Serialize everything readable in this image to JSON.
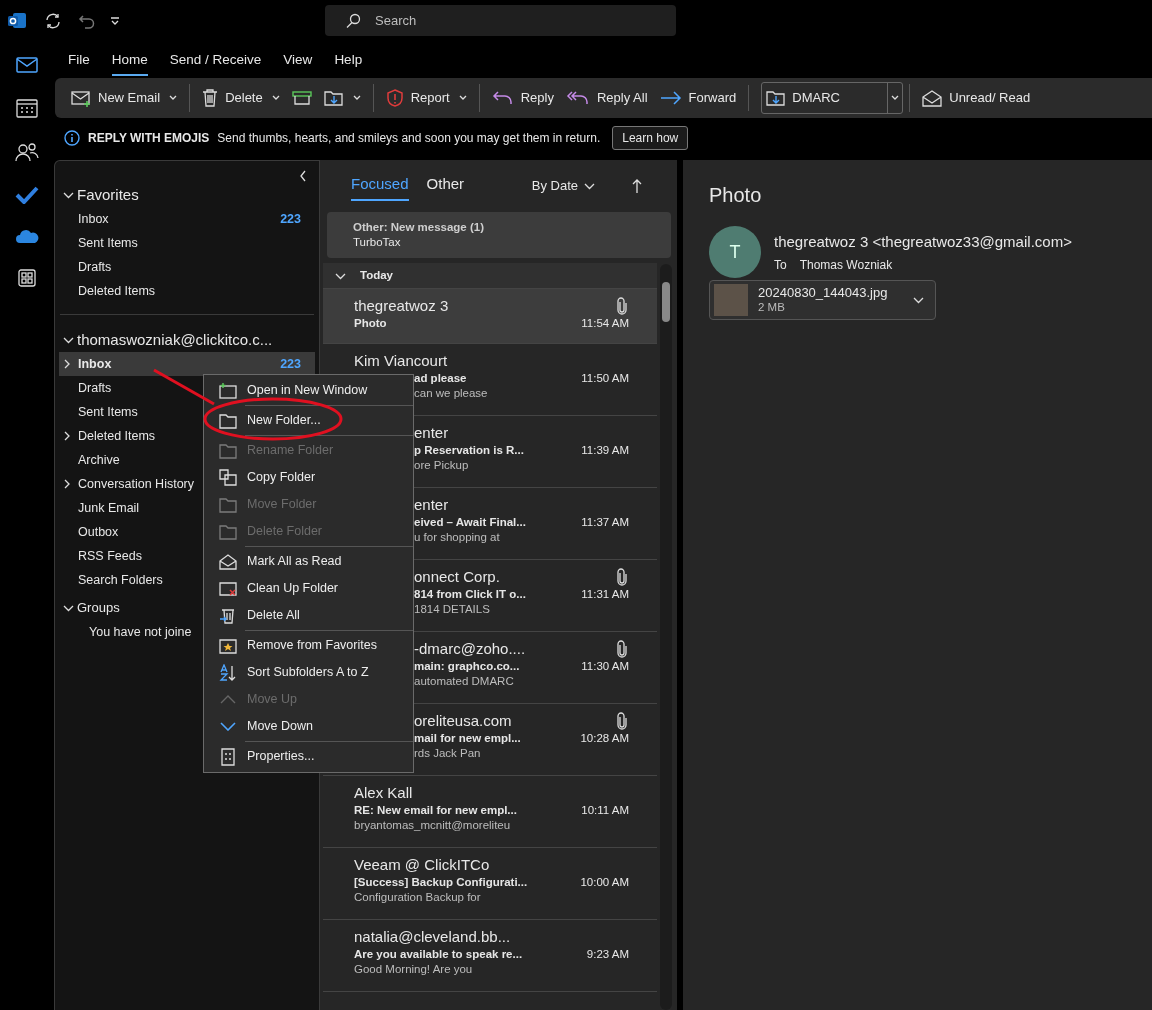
{
  "title_bar": {
    "search_placeholder": "Search"
  },
  "menu_tabs": [
    {
      "label": "File",
      "selected": false
    },
    {
      "label": "Home",
      "selected": true
    },
    {
      "label": "Send / Receive",
      "selected": false
    },
    {
      "label": "View",
      "selected": false
    },
    {
      "label": "Help",
      "selected": false
    }
  ],
  "ribbon": [
    {
      "label": "New Email",
      "dropdown": true,
      "group_start": false
    },
    {
      "label": "Delete",
      "dropdown": true,
      "group_start": true
    },
    {
      "dropdown": false,
      "group_start": false
    },
    {
      "dropdown": true,
      "group_start": false
    },
    {
      "label": "Report",
      "dropdown": true,
      "group_start": true
    },
    {
      "label": "Reply",
      "dropdown": false,
      "group_start": true
    },
    {
      "label": "Reply All",
      "dropdown": false,
      "group_start": false
    },
    {
      "label": "Forward",
      "dropdown": false,
      "group_start": false
    },
    {
      "label": "DMARC",
      "dropdown": true,
      "group_start": true
    },
    {
      "label": "Unread/ Read",
      "dropdown": false,
      "group_start": true
    }
  ],
  "info_bar": {
    "title": "REPLY WITH EMOJIS",
    "text": "Send thumbs, hearts, and smileys and soon you may get them in return.",
    "button": "Learn how"
  },
  "folder_sections": [
    {
      "title": "Favorites",
      "expanded": true,
      "items": [
        {
          "name": "Inbox",
          "count": "223",
          "selected": false,
          "expandable": false
        },
        {
          "name": "Sent Items",
          "selected": false,
          "expandable": false
        },
        {
          "name": "Drafts",
          "selected": false,
          "expandable": false
        },
        {
          "name": "Deleted Items",
          "selected": false,
          "expandable": false
        }
      ]
    },
    {
      "title": "thomaswozniak@clickitco.c...",
      "expanded": true,
      "items": [
        {
          "name": "Inbox",
          "count": "223",
          "selected": true,
          "expandable": true
        },
        {
          "name": "Drafts",
          "selected": false,
          "expandable": false
        },
        {
          "name": "Sent Items",
          "selected": false,
          "expandable": false
        },
        {
          "name": "Deleted Items",
          "selected": false,
          "expandable": true
        },
        {
          "name": "Archive",
          "selected": false,
          "expandable": false
        },
        {
          "name": "Conversation History",
          "selected": false,
          "expandable": true
        },
        {
          "name": "Junk Email",
          "selected": false,
          "expandable": false
        },
        {
          "name": "Outbox",
          "selected": false,
          "expandable": false
        },
        {
          "name": "RSS Feeds",
          "selected": false,
          "expandable": false
        },
        {
          "name": "Search Folders",
          "selected": false,
          "expandable": false
        }
      ]
    },
    {
      "title": "Groups",
      "expanded": true,
      "note": "You have not joine"
    }
  ],
  "message_list": {
    "tabs": [
      {
        "label": "Focused",
        "selected": true
      },
      {
        "label": "Other",
        "selected": false
      }
    ],
    "sort": "By Date",
    "other_banner": {
      "title": "Other: New message (1)",
      "sender": "TurboTax"
    },
    "group_header": "Today",
    "messages": [
      {
        "sender": "thegreatwoz 3",
        "subject": "Photo",
        "time": "11:54 AM",
        "attachment": true,
        "selected": true,
        "sender_covered": false,
        "lines_covered": false
      },
      {
        "sender": "Kim Viancourt",
        "subject": "ad please",
        "preview": "can we please",
        "time": "11:50 AM",
        "attachment": false,
        "selected": false,
        "sender_covered": false,
        "lines_covered": true
      },
      {
        "sender": "enter",
        "subject": "p Reservation is R...",
        "preview": "ore Pickup",
        "time": "11:39 AM",
        "attachment": false,
        "selected": false,
        "sender_covered": true,
        "lines_covered": true
      },
      {
        "sender": "enter",
        "subject": "eived – Await Final...",
        "preview": "u for shopping at",
        "time": "11:37 AM",
        "attachment": false,
        "selected": false,
        "sender_covered": true,
        "lines_covered": true
      },
      {
        "sender": "onnect Corp.",
        "subject": "814 from Click IT o...",
        "preview": "1814 DETAILS",
        "time": "11:31 AM",
        "attachment": true,
        "selected": false,
        "sender_covered": true,
        "lines_covered": true
      },
      {
        "sender": "-dmarc@zoho....",
        "subject": "main: graphco.co...",
        "preview": "automated DMARC",
        "time": "11:30 AM",
        "attachment": true,
        "selected": false,
        "sender_covered": true,
        "lines_covered": true
      },
      {
        "sender": "oreliteusa.com",
        "subject": "mail for new empl...",
        "preview": "rds Jack Pan",
        "time": "10:28 AM",
        "attachment": true,
        "selected": false,
        "sender_covered": true,
        "lines_covered": true
      },
      {
        "sender": "Alex Kall",
        "subject": "RE: New email for new empl...",
        "preview": "bryantomas_mcnitt@moreliteu",
        "time": "10:11 AM",
        "attachment": false,
        "selected": false,
        "sender_covered": false,
        "lines_covered": false
      },
      {
        "sender": "Veeam @ ClickITCo",
        "subject": "[Success] Backup Configurati...",
        "preview": "Configuration Backup for",
        "time": "10:00 AM",
        "attachment": false,
        "selected": false,
        "sender_covered": false,
        "lines_covered": false
      },
      {
        "sender": "natalia@cleveland.bb...",
        "subject": "Are you available to speak re...",
        "preview": "Good Morning!  Are you",
        "time": "9:23 AM",
        "attachment": false,
        "selected": false,
        "sender_covered": false,
        "lines_covered": false
      }
    ]
  },
  "context_menu": [
    [
      {
        "label": "Open in New Window",
        "disabled": false
      }
    ],
    [
      {
        "label": "New Folder...",
        "disabled": false
      }
    ],
    [
      {
        "label": "Rename Folder",
        "disabled": true
      },
      {
        "label": "Copy Folder",
        "disabled": false
      },
      {
        "label": "Move Folder",
        "disabled": true
      },
      {
        "label": "Delete Folder",
        "disabled": true
      }
    ],
    [
      {
        "label": "Mark All as Read",
        "disabled": false
      },
      {
        "label": "Clean Up Folder",
        "disabled": false
      },
      {
        "label": "Delete All",
        "disabled": false
      }
    ],
    [
      {
        "label": "Remove from Favorites",
        "disabled": false
      },
      {
        "label": "Sort Subfolders A to Z",
        "disabled": false
      },
      {
        "label": "Move Up",
        "disabled": true
      },
      {
        "label": "Move Down",
        "disabled": false
      }
    ],
    [
      {
        "label": "Properties...",
        "disabled": false
      }
    ]
  ],
  "reading_pane": {
    "subject": "Photo",
    "avatar_initial": "T",
    "from": "thegreatwoz 3 <thegreatwoz33@gmail.com>",
    "to_label": "To",
    "to": "Thomas Wozniak",
    "attachment": {
      "name": "20240830_144043.jpg",
      "size": "2 MB"
    }
  }
}
